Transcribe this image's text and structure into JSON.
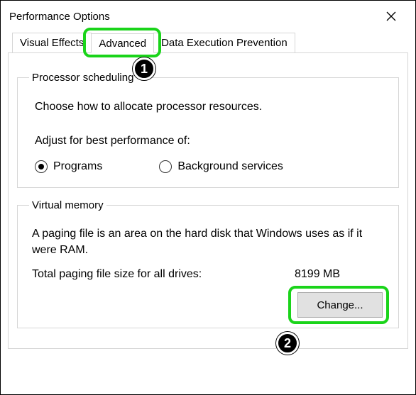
{
  "window": {
    "title": "Performance Options"
  },
  "tabs": {
    "visual_effects": "Visual Effects",
    "advanced": "Advanced",
    "dep": "Data Execution Prevention",
    "active": "advanced"
  },
  "processor": {
    "legend": "Processor scheduling",
    "description": "Choose how to allocate processor resources.",
    "subhead": "Adjust for best performance of:",
    "option_programs": "Programs",
    "option_background": "Background services",
    "selected": "programs"
  },
  "virtual_memory": {
    "legend": "Virtual memory",
    "description": "A paging file is an area on the hard disk that Windows uses as if it were RAM.",
    "total_label": "Total paging file size for all drives:",
    "total_value": "8199 MB",
    "change_button": "Change..."
  },
  "annotations": {
    "step1": "1",
    "step2": "2"
  }
}
